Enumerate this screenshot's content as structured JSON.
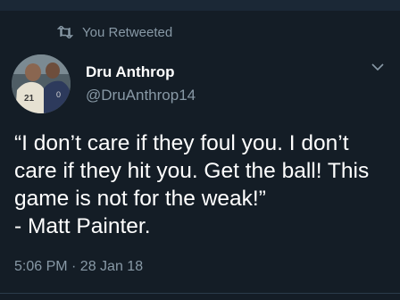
{
  "retweet": {
    "label": "You Retweeted",
    "icon": "retweet-icon"
  },
  "author": {
    "name": "Dru Anthrop",
    "handle": "@DruAnthrop14"
  },
  "tweet": {
    "text": "“I don’t care if they foul you. I don’t care if they hit you. Get the ball! This game is not for the weak!”\n- Matt Painter.",
    "timestamp": "5:06 PM · 28 Jan 18"
  },
  "colors": {
    "background": "#141d26",
    "muted": "#8899a6",
    "text": "#ffffff"
  }
}
